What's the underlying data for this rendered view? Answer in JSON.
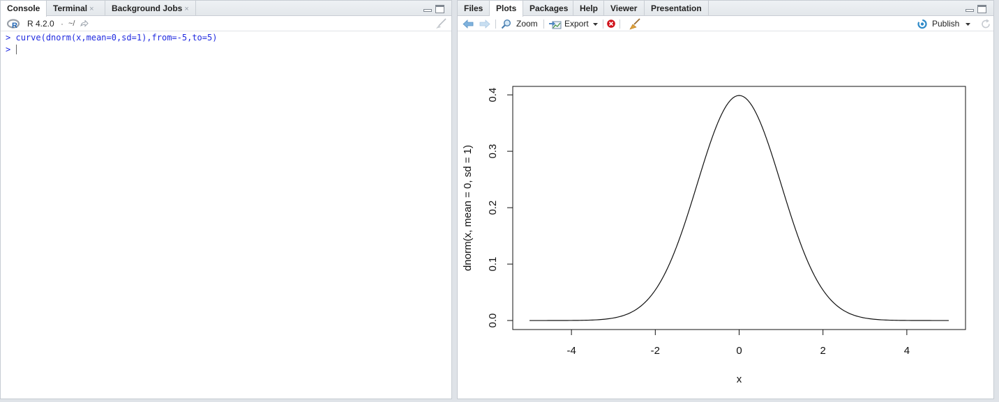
{
  "left_pane": {
    "tabs": [
      {
        "label": "Console"
      },
      {
        "label": "Terminal",
        "close": "×"
      },
      {
        "label": "Background Jobs",
        "close": "×"
      }
    ],
    "r_version": "R 4.2.0",
    "separator": "·",
    "working_dir": "~/",
    "console": {
      "prompt": ">",
      "command": "curve(dnorm(x,mean=0,sd=1),from=-5,to=5)",
      "input_prompt": ">"
    }
  },
  "right_pane": {
    "tabs": [
      {
        "label": "Files"
      },
      {
        "label": "Plots"
      },
      {
        "label": "Packages"
      },
      {
        "label": "Help"
      },
      {
        "label": "Viewer"
      },
      {
        "label": "Presentation"
      }
    ],
    "toolbar": {
      "zoom_label": "Zoom",
      "export_label": "Export",
      "publish_label": "Publish"
    }
  },
  "colors": {
    "console_text": "#1f2ae0",
    "pane_border": "#c7ccd3",
    "background": "#dfe3e8",
    "delete_icon": "#d0121b",
    "publish_icon": "#2e8ac8"
  },
  "chart_data": {
    "type": "line",
    "xlabel": "x",
    "ylabel": "dnorm(x, mean = 0, sd = 1)",
    "x_ticks": [
      "-4",
      "-2",
      "0",
      "2",
      "4"
    ],
    "y_ticks": [
      "0.0",
      "0.1",
      "0.2",
      "0.3",
      "0.4"
    ],
    "xlim": [
      -5.4,
      5.4
    ],
    "ylim": [
      -0.016,
      0.415
    ],
    "grid": false,
    "function": "dnorm(x, mean = 0, sd = 1)",
    "from": -5,
    "to": 5
  }
}
